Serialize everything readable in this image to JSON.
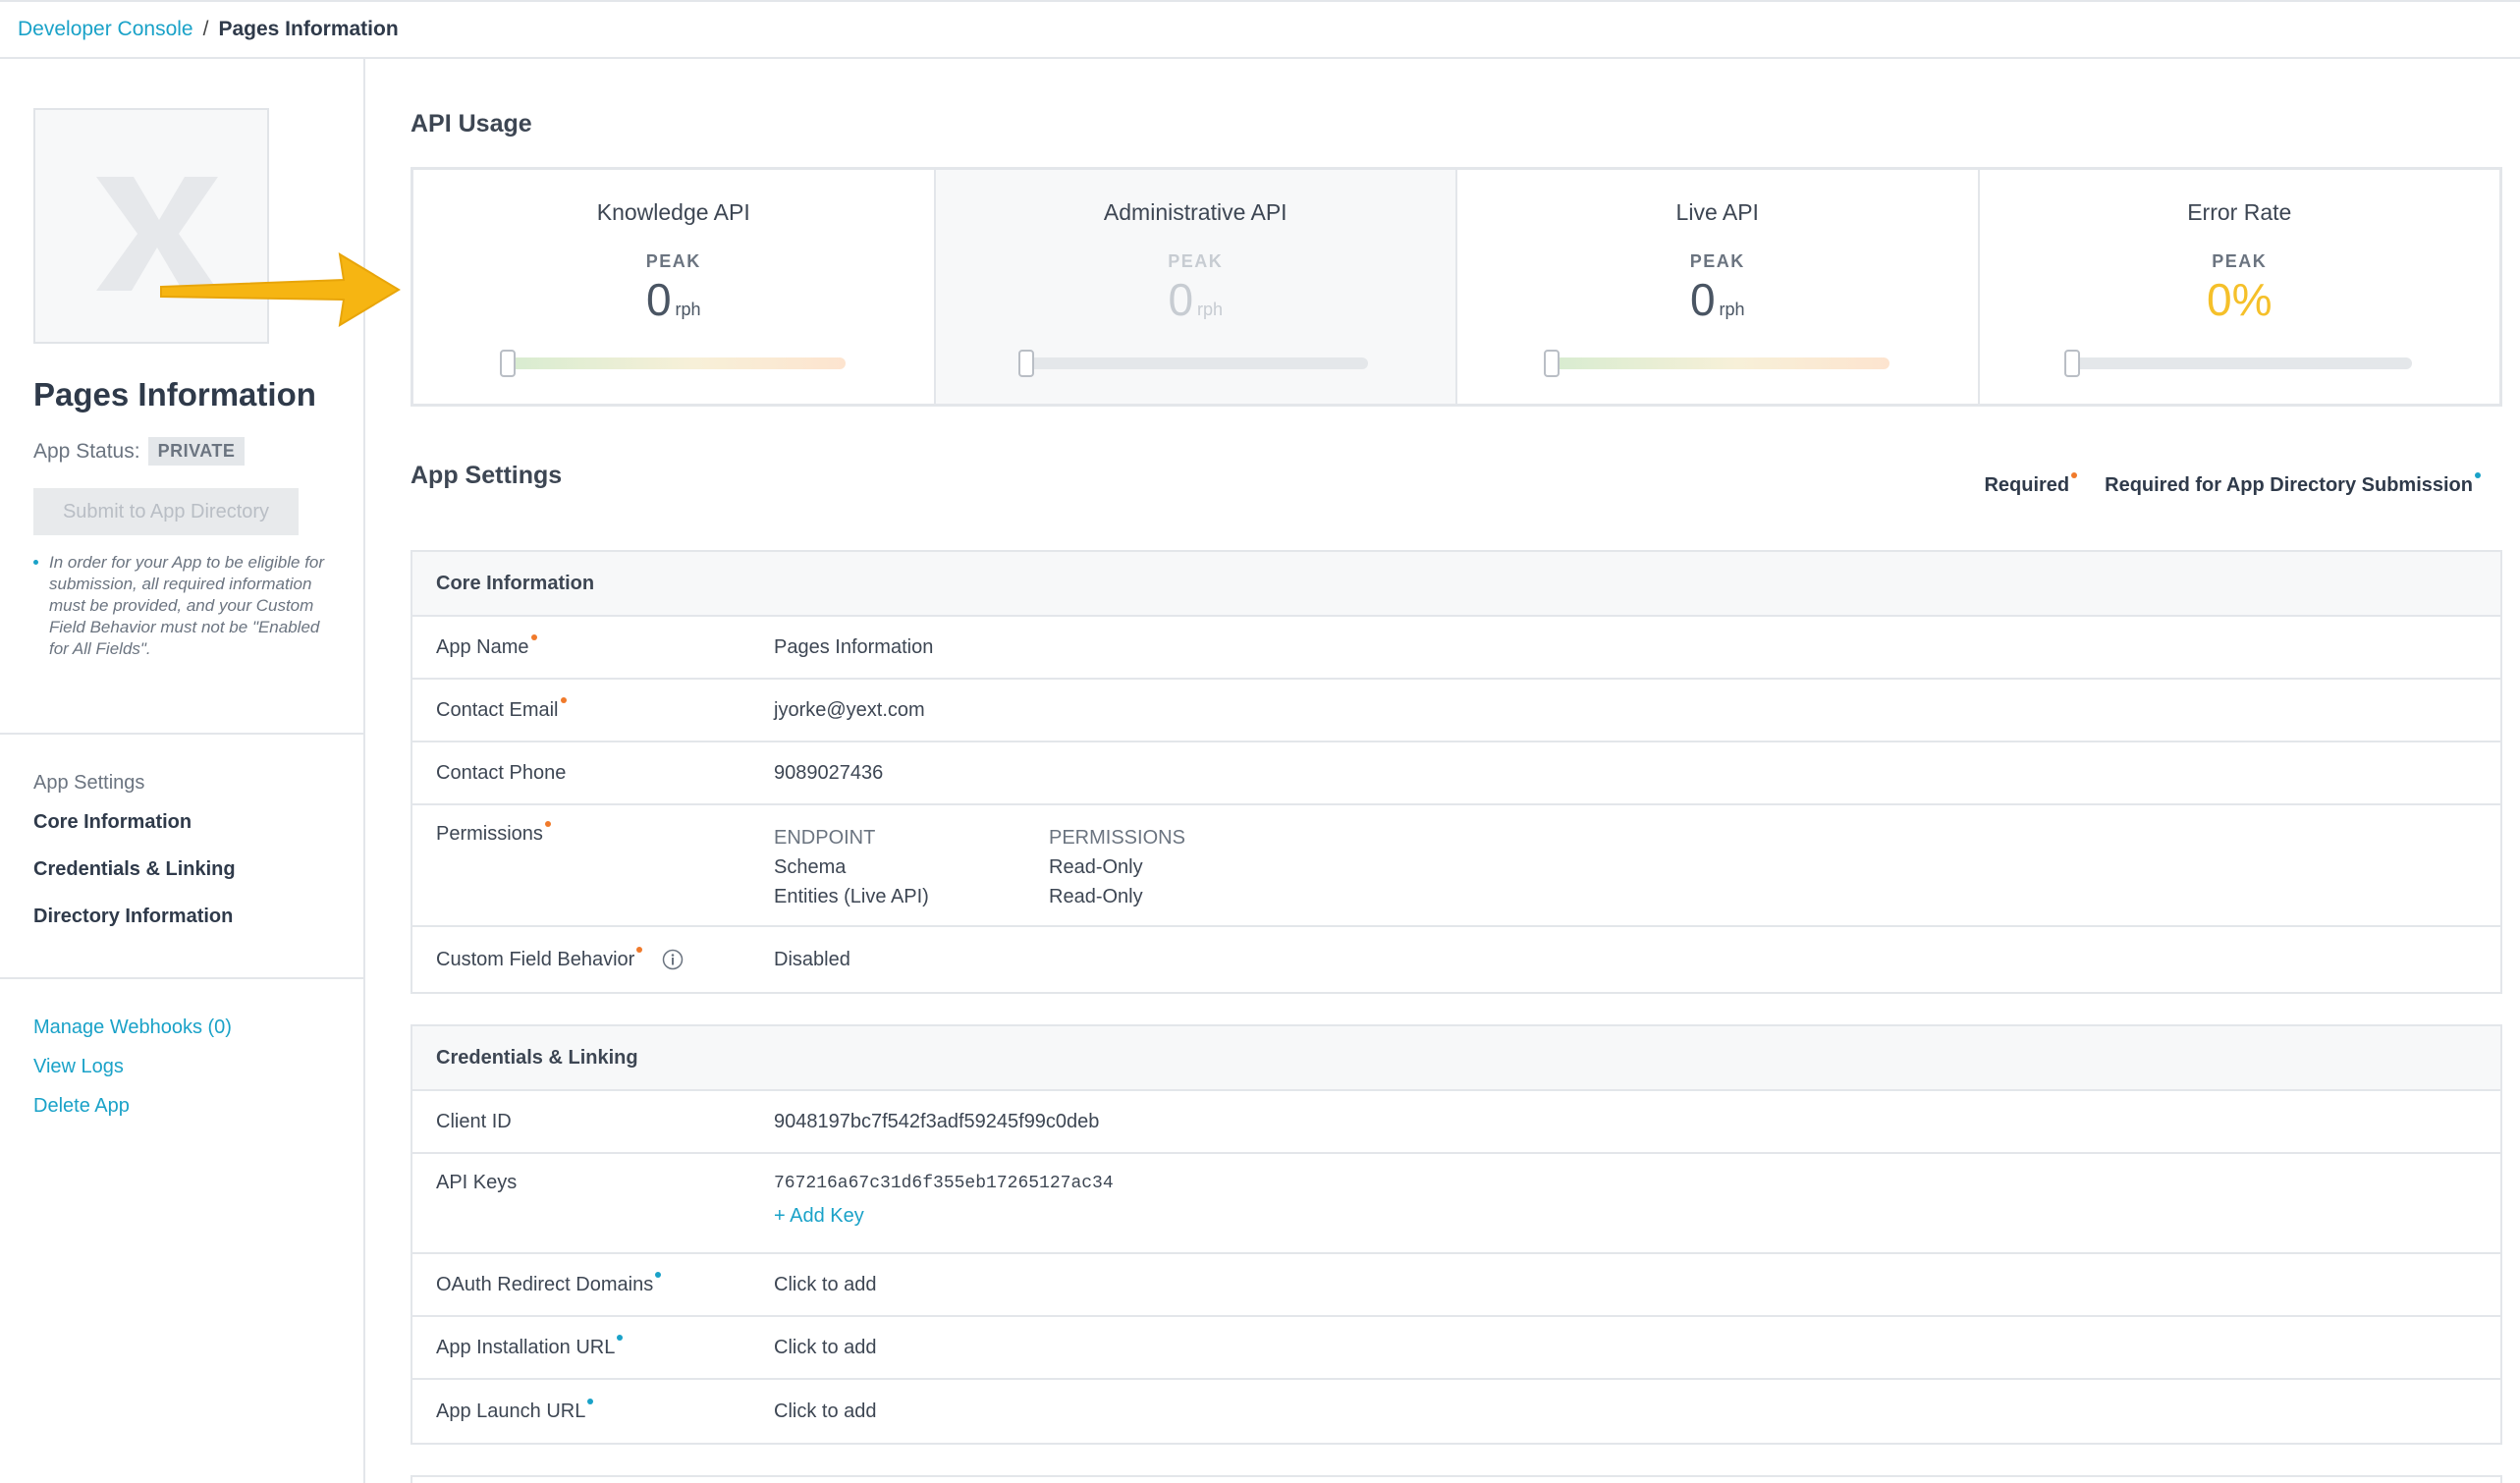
{
  "breadcrumb": {
    "root": "Developer Console",
    "separator": "/",
    "current": "Pages Information"
  },
  "sidebar": {
    "app_title": "Pages Information",
    "status_label": "App Status:",
    "status_badge": "PRIVATE",
    "submit_button": "Submit to App Directory",
    "note": "In order for your App to be eligible for submission, all required information must be provided, and your Custom Field Behavior must not be \"Enabled for All Fields\".",
    "settings_title": "App Settings",
    "nav": [
      "Core Information",
      "Credentials & Linking",
      "Directory Information"
    ],
    "links": [
      "Manage Webhooks (0)",
      "View Logs",
      "Delete App"
    ]
  },
  "api_usage": {
    "title": "API Usage",
    "cards": [
      {
        "title": "Knowledge API",
        "peak": "PEAK",
        "value": "0",
        "unit": "rph",
        "level": 0
      },
      {
        "title": "Administrative API",
        "peak": "PEAK",
        "value": "0",
        "unit": "rph",
        "level": 0
      },
      {
        "title": "Live API",
        "peak": "PEAK",
        "value": "0",
        "unit": "rph",
        "level": 0
      },
      {
        "title": "Error Rate",
        "peak": "PEAK",
        "value": "0%",
        "unit": "",
        "level": 0
      }
    ]
  },
  "app_settings": {
    "title": "App Settings",
    "legend_required": "Required",
    "legend_directory": "Required for App Directory Submission",
    "core": {
      "header": "Core Information",
      "app_name_label": "App Name",
      "app_name": "Pages Information",
      "contact_email_label": "Contact Email",
      "contact_email": "jyorke@yext.com",
      "contact_phone_label": "Contact Phone",
      "contact_phone": "9089027436",
      "permissions_label": "Permissions",
      "perm_endpoint_head": "ENDPOINT",
      "perm_permissions_head": "PERMISSIONS",
      "permissions": [
        {
          "endpoint": "Schema",
          "permission": "Read-Only"
        },
        {
          "endpoint": "Entities (Live API)",
          "permission": "Read-Only"
        }
      ],
      "custom_field_label": "Custom Field Behavior",
      "custom_field": "Disabled"
    },
    "credentials": {
      "header": "Credentials & Linking",
      "client_id_label": "Client ID",
      "client_id": "9048197bc7f542f3adf59245f99c0deb",
      "api_keys_label": "API Keys",
      "api_key": "767216a67c31d6f355eb17265127ac34",
      "add_key": "+ Add Key",
      "oauth_label": "OAuth Redirect Domains",
      "oauth_value": "Click to add",
      "install_label": "App Installation URL",
      "install_value": "Click to add",
      "launch_label": "App Launch URL",
      "launch_value": "Click to add"
    }
  },
  "colors": {
    "link": "#1aa2c8",
    "required_dot": "#f07a2b",
    "directory_dot": "#1aa2c8",
    "error_rate": "#f5c02a",
    "arrow": "#f6b512"
  }
}
